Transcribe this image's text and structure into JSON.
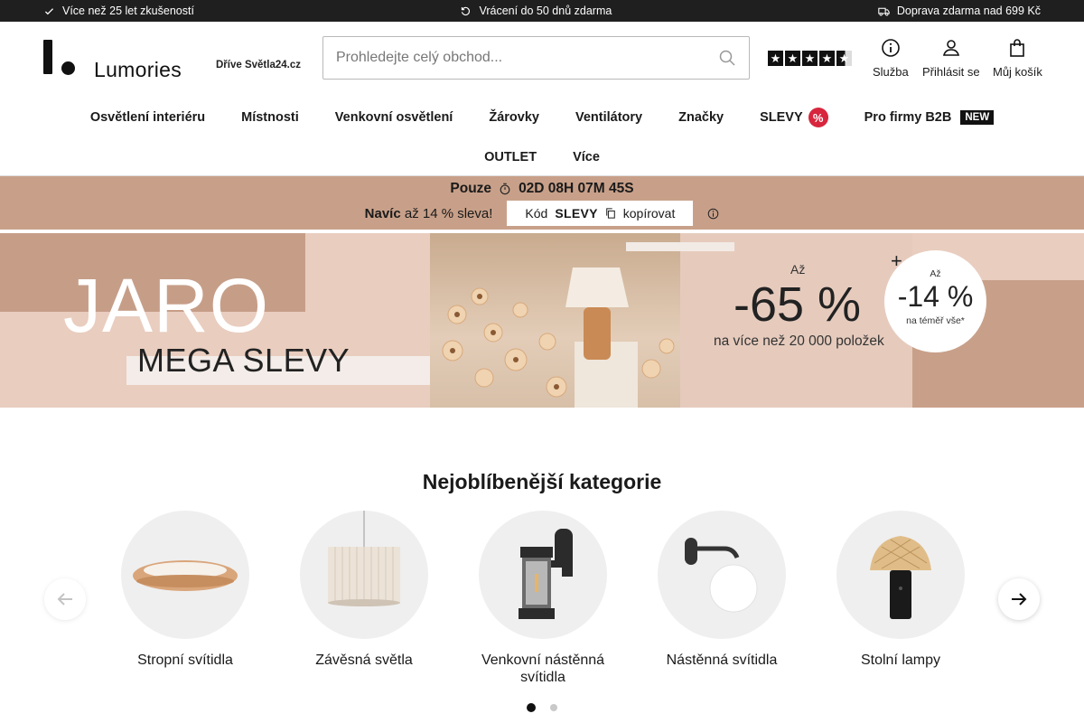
{
  "topbar": {
    "left": "Více než 25 let zkušeností",
    "center": "Vrácení do 50 dnů zdarma",
    "right": "Doprava zdarma nad 699 Kč"
  },
  "header": {
    "logo": "Lumories",
    "formerly": "Dříve Světla24.cz",
    "search_placeholder": "Prohledejte celý obchod...",
    "service": "Služba",
    "login": "Přihlásit se",
    "cart": "Můj košík"
  },
  "nav": {
    "row1": [
      "Osvětlení interiéru",
      "Místnosti",
      "Venkovní osvětlení",
      "Žárovky",
      "Ventilátory",
      "Značky",
      "SLEVY",
      "Pro firmy B2B"
    ],
    "new_tag": "NEW",
    "row2": [
      "OUTLET",
      "Více"
    ]
  },
  "promo": {
    "only": "Pouze",
    "countdown": "02D 08H 07M 45S",
    "extra_bold": "Navíc",
    "extra": "až 14 % sleva!",
    "code_label": "Kód",
    "code": "SLEVY",
    "copy": "kopírovat"
  },
  "hero": {
    "title": "JARO",
    "subtitle": "MEGA SLEVY",
    "up_to": "Až",
    "discount": "-65 %",
    "items": "na více než 20 000 položek",
    "plus": "+",
    "circle_up_to": "Až",
    "circle_discount": "-14 %",
    "circle_note": "na téměř vše*"
  },
  "categories": {
    "title": "Nejoblíbenější kategorie",
    "items": [
      {
        "label": "Stropní svítidla"
      },
      {
        "label": "Závěsná světla"
      },
      {
        "label": "Venkovní nástěnná svítidla"
      },
      {
        "label": "Nástěnná svítidla"
      },
      {
        "label": "Stolní lampy"
      }
    ],
    "page_count": 2,
    "active_page": 1
  },
  "colors": {
    "promo_bg": "#c8a089",
    "sale_badge": "#d7263d",
    "topbar_bg": "#1f1f1f"
  }
}
